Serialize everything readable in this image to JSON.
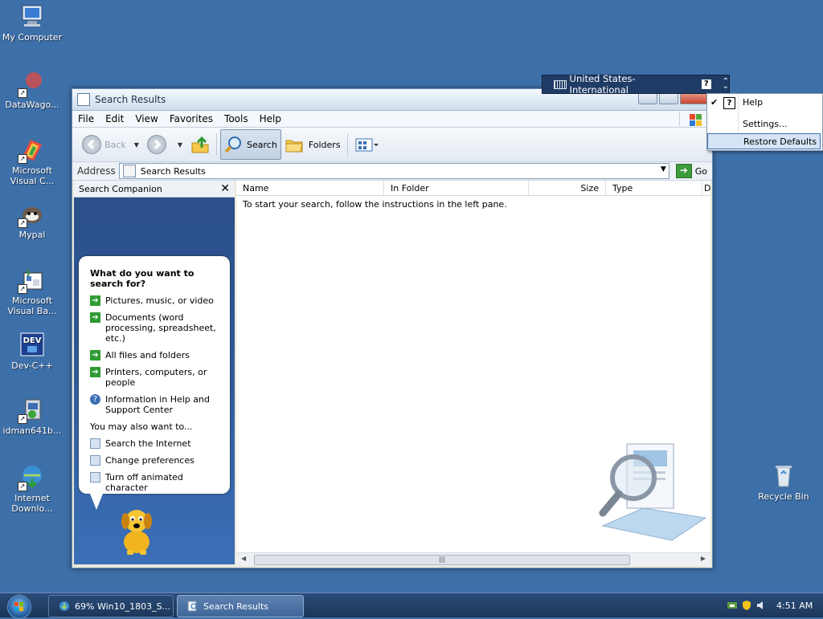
{
  "desktop": {
    "icons": [
      {
        "label": "My Computer",
        "icon": "computer-icon"
      },
      {
        "label": "DataWago...",
        "icon": "datawagon-icon"
      },
      {
        "label": "Microsoft Visual C...",
        "icon": "visual-c-icon"
      },
      {
        "label": "Mypal",
        "icon": "mypal-icon"
      },
      {
        "label": "Microsoft Visual Ba...",
        "icon": "visual-basic-icon"
      },
      {
        "label": "Dev-C++",
        "icon": "devcpp-icon"
      },
      {
        "label": "idman641b...",
        "icon": "idm-installer-icon"
      },
      {
        "label": "Internet Downlo...",
        "icon": "idm-icon"
      },
      {
        "label": "Recycle Bin",
        "icon": "recycle-bin-icon"
      }
    ]
  },
  "window": {
    "title": "Search Results",
    "menu": [
      "File",
      "Edit",
      "View",
      "Favorites",
      "Tools",
      "Help"
    ],
    "toolbar": {
      "back": "Back",
      "search": "Search",
      "folders": "Folders"
    },
    "address": {
      "label": "Address",
      "value": "Search Results",
      "go": "Go"
    },
    "companion": {
      "title": "Search Companion",
      "question": "What do you want to search for?",
      "options": [
        "Pictures, music, or video",
        "Documents (word processing, spreadsheet, etc.)",
        "All files and folders",
        "Printers, computers, or people",
        "Information in Help and Support Center"
      ],
      "also_label": "You may also want to...",
      "also": [
        "Search the Internet",
        "Change preferences",
        "Turn off animated character"
      ]
    },
    "results": {
      "columns": [
        "Name",
        "In Folder",
        "Size",
        "Type",
        "D"
      ],
      "hint": "To start your search, follow the instructions in the left pane."
    }
  },
  "langbar": {
    "language": "United States-International",
    "menu": {
      "help": "Help",
      "settings": "Settings...",
      "restore": "Restore Defaults",
      "help_checked": true
    }
  },
  "taskbar": {
    "tasks": [
      "69% Win10_1803_S...",
      "Search Results"
    ],
    "clock": "4:51 AM"
  },
  "colors": {
    "desktop": "#3d6fa8",
    "taskbar": "#1c3658",
    "langbar": "#1f3c66"
  }
}
